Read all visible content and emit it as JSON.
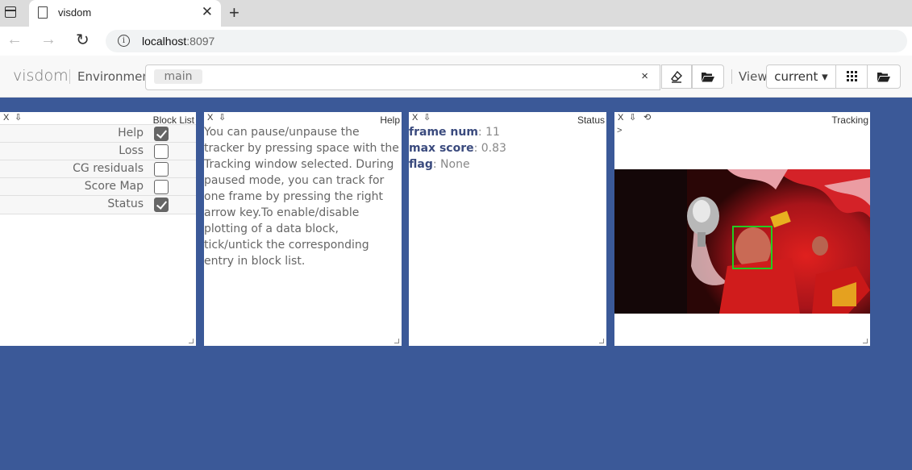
{
  "browser": {
    "tab_title": "visdom",
    "url_host": "localhost",
    "url_port": ":8097",
    "new_tab_glyph": "+",
    "close_glyph": "✕",
    "info_glyph": "i"
  },
  "toolbar": {
    "brand": "visdom",
    "environment_label": "Environment",
    "env_selected": "main",
    "env_clear_glyph": "×",
    "view_label": "View",
    "view_current": "current ▾",
    "icons": [
      "eraser-icon",
      "folder-open-icon",
      "grid-icon",
      "folder-open-icon"
    ]
  },
  "panes": {
    "block_list": {
      "title": "Block List",
      "close": "X",
      "download": "⇩",
      "items": [
        {
          "label": "Help",
          "checked": true
        },
        {
          "label": "Loss",
          "checked": false
        },
        {
          "label": "CG residuals",
          "checked": false
        },
        {
          "label": "Score Map",
          "checked": false
        },
        {
          "label": "Status",
          "checked": true
        }
      ]
    },
    "help": {
      "title": "Help",
      "close": "X",
      "download": "⇩",
      "text": "You can pause/unpause the tracker by pressing space with the Tracking window selected. During paused mode, you can track for one frame by pressing the right arrow key.To enable/disable plotting of a data block, tick/untick the corresponding entry in block list."
    },
    "status": {
      "title": "Status",
      "close": "X",
      "download": "⇩",
      "rows": [
        {
          "key": "frame num",
          "value": ": 11"
        },
        {
          "key": "max score",
          "value": ": 0.83"
        },
        {
          "key": "flag",
          "value": ": None"
        }
      ]
    },
    "tracking": {
      "title": "Tracking",
      "close": "X",
      "download": "⇩",
      "refresh": "⟲",
      "prompt": ">",
      "box_color": "#22cc22"
    }
  },
  "colors": {
    "background": "#3b5998",
    "status_key": "#3b4b7e"
  }
}
